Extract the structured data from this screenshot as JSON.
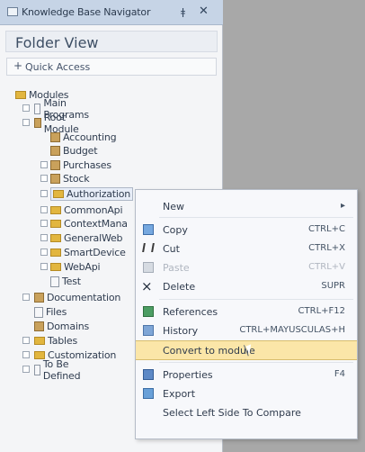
{
  "window": {
    "title": "Knowledge Base Navigator",
    "pin_icon": "pin-icon",
    "close_icon": "close-icon"
  },
  "panel": {
    "title": "Folder View",
    "quick_access": "Quick Access"
  },
  "tree": {
    "items": [
      {
        "label": "Modules",
        "kind": "folder",
        "expanded": true
      },
      {
        "label": "Main Programs",
        "kind": "doc"
      },
      {
        "label": "Root Module",
        "kind": "module",
        "expanded": true
      },
      {
        "label": "Accounting",
        "kind": "module"
      },
      {
        "label": "Budget",
        "kind": "module"
      },
      {
        "label": "Purchases",
        "kind": "module"
      },
      {
        "label": "Stock",
        "kind": "module"
      },
      {
        "label": "Authorization",
        "kind": "folder",
        "selected": true
      },
      {
        "label": "CommonApi",
        "kind": "folder"
      },
      {
        "label": "ContextMana",
        "kind": "folder"
      },
      {
        "label": "GeneralWeb",
        "kind": "folder"
      },
      {
        "label": "SmartDevice",
        "kind": "folder"
      },
      {
        "label": "WebApi",
        "kind": "folder"
      },
      {
        "label": "Test",
        "kind": "doc"
      },
      {
        "label": "Documentation",
        "kind": "module"
      },
      {
        "label": "Files",
        "kind": "doc"
      },
      {
        "label": "Domains",
        "kind": "module"
      },
      {
        "label": "Tables",
        "kind": "folder"
      },
      {
        "label": "Customization",
        "kind": "folder"
      },
      {
        "label": "To Be Defined",
        "kind": "doc"
      }
    ]
  },
  "context_menu": {
    "items": [
      {
        "label": "New",
        "shortcut": "",
        "icon": "",
        "submenu": true
      },
      {
        "label": "Copy",
        "shortcut": "CTRL+C",
        "icon": "copy-icon"
      },
      {
        "label": "Cut",
        "shortcut": "CTRL+X",
        "icon": "cut-icon"
      },
      {
        "label": "Paste",
        "shortcut": "CTRL+V",
        "icon": "paste-icon",
        "disabled": true
      },
      {
        "label": "Delete",
        "shortcut": "SUPR",
        "icon": "delete-icon"
      },
      {
        "label": "References",
        "shortcut": "CTRL+F12",
        "icon": "references-icon"
      },
      {
        "label": "History",
        "shortcut": "CTRL+MAYUSCULAS+H",
        "icon": "history-icon"
      },
      {
        "label": "Convert to module",
        "shortcut": "",
        "icon": "",
        "highlighted": true
      },
      {
        "label": "Properties",
        "shortcut": "F4",
        "icon": "properties-icon"
      },
      {
        "label": "Export",
        "shortcut": "",
        "icon": "export-icon"
      },
      {
        "label": "Select Left Side To Compare",
        "shortcut": "",
        "icon": ""
      }
    ]
  }
}
